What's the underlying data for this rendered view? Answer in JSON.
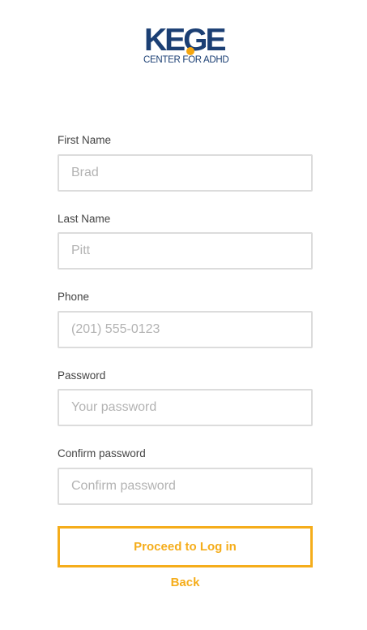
{
  "logo": {
    "wordmark": "KEGE",
    "subtitle": "CENTER FOR ADHD"
  },
  "form": {
    "first_name": {
      "label": "First Name",
      "placeholder": "Brad"
    },
    "last_name": {
      "label": "Last Name",
      "placeholder": "Pitt"
    },
    "phone": {
      "label": "Phone",
      "placeholder": "(201) 555-0123"
    },
    "password": {
      "label": "Password",
      "placeholder": "Your password"
    },
    "confirm_password": {
      "label": "Confirm password",
      "placeholder": "Confirm password"
    }
  },
  "actions": {
    "proceed_label": "Proceed to Log in",
    "back_label": "Back"
  },
  "colors": {
    "brand_navy": "#1b3f74",
    "accent_orange": "#f5ad1b",
    "input_border": "#dcdcdc"
  }
}
